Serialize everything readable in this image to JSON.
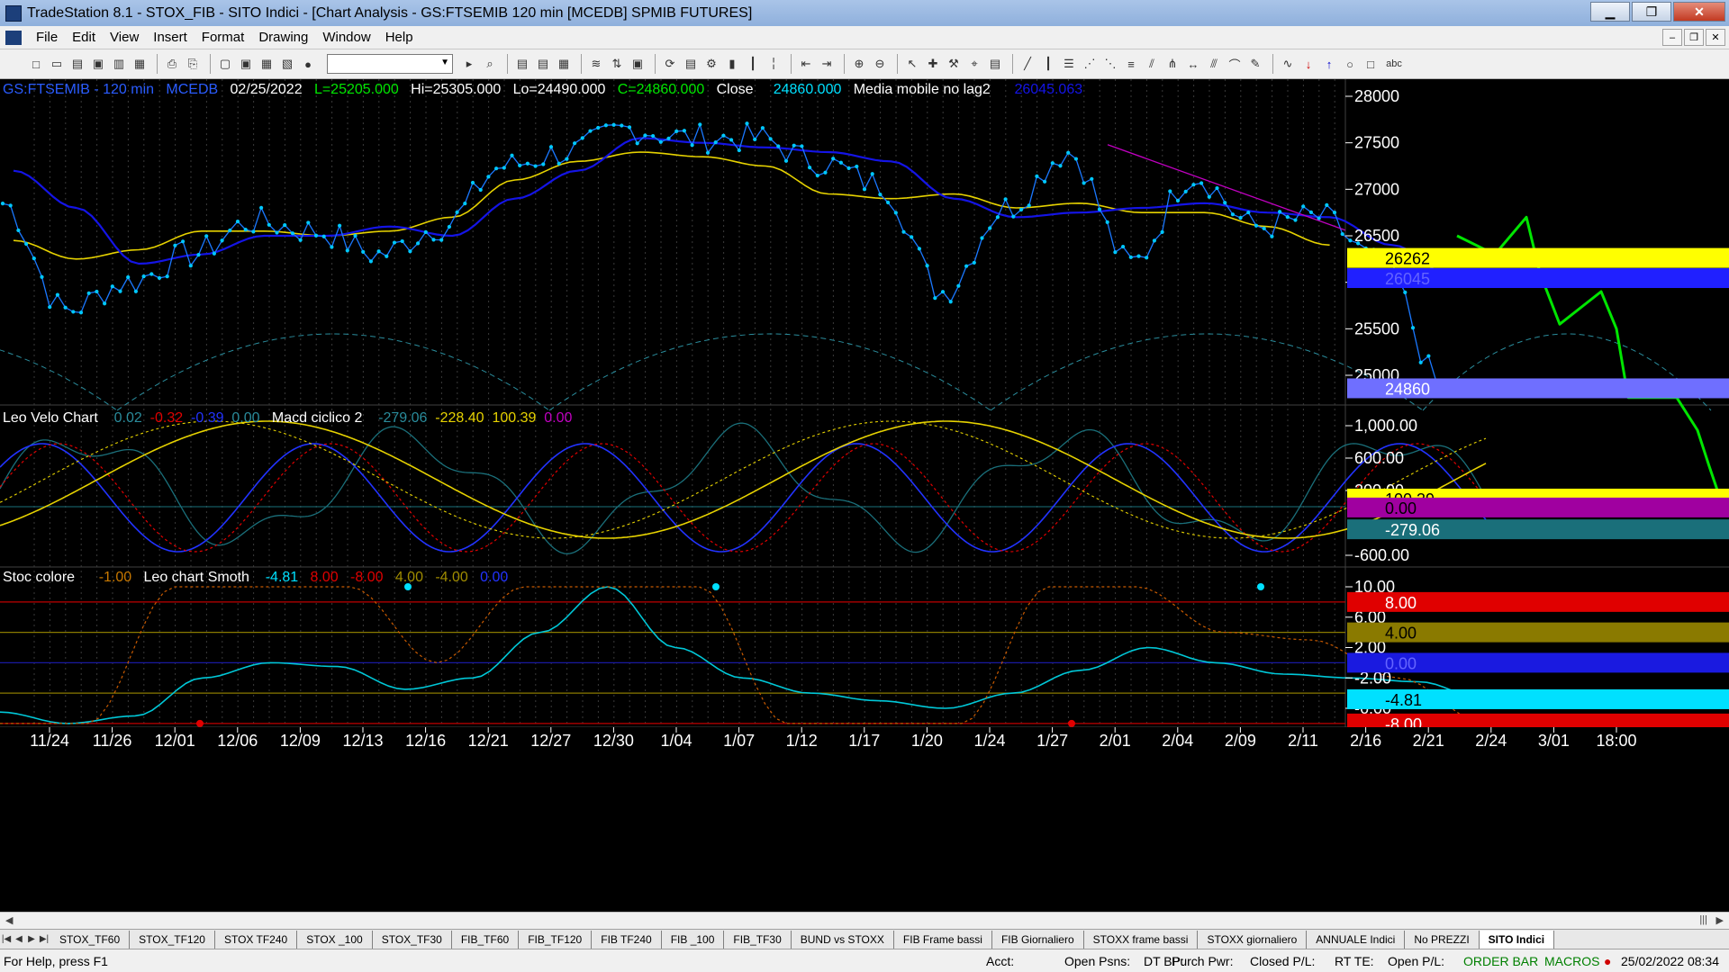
{
  "window": {
    "title": "TradeStation 8.1 - STOX_FIB - SITO Indici - [Chart Analysis - GS:FTSEMIB  120 min  [MCEDB] SPMIB FUTURES]"
  },
  "menu": [
    "File",
    "Edit",
    "View",
    "Insert",
    "Format",
    "Drawing",
    "Window",
    "Help"
  ],
  "price_header": {
    "symbol": "GS:FTSEMIB - 120 min",
    "data_source": "MCEDB",
    "date": "02/25/2022",
    "last": "L=25205.000",
    "high": "Hi=25305.000",
    "low": "Lo=24490.000",
    "close_value": "C=24860.000",
    "close_label": "Close",
    "close_num": "24860.000",
    "ma_label": "Media mobile no lag2",
    "ma_value": "26045.063"
  },
  "velo_header": {
    "name": "Leo Velo Chart",
    "v1": "0.02",
    "v2": "-0.32",
    "v3": "-0.39",
    "v4": "0.00",
    "macd_name": "Macd ciclico 2",
    "m1": "-279.06",
    "m2": "-228.40",
    "m3": "100.39",
    "m4": "0.00"
  },
  "stoc_header": {
    "name": "Stoc colore",
    "s1": "-1.00",
    "smooth_name": "Leo chart Smoth",
    "s2": "-4.81",
    "s3": "8.00",
    "s4": "-8.00",
    "s5": "4.00",
    "s6": "-4.00",
    "s7": "0.00"
  },
  "colors": {
    "price": "#00c8ff",
    "blue_ma": "#1414e6",
    "yellow_ma": "#e6d200",
    "trendline": "#c000c0",
    "projection": "#00e600",
    "cycle": "#2a8c9c",
    "red": "#e00000",
    "background": "#000000"
  },
  "chart_data": [
    {
      "type": "line",
      "title": "GS:FTSEMIB - 120 min",
      "x": [
        "11/24",
        "11/26",
        "12/01",
        "12/06",
        "12/09",
        "12/13",
        "12/16",
        "12/21",
        "12/27",
        "12/30",
        "1/04",
        "1/07",
        "1/12",
        "1/17",
        "1/20",
        "1/24",
        "1/27",
        "2/01",
        "2/04",
        "2/09",
        "2/11",
        "2/16",
        "2/21",
        "2/24"
      ],
      "x_axis_labels": [
        "11/24",
        "11/26",
        "12/01",
        "12/06",
        "12/09",
        "12/13",
        "12/16",
        "12/21",
        "12/27",
        "12/30",
        "1/04",
        "1/07",
        "1/12",
        "1/17",
        "1/20",
        "1/24",
        "1/27",
        "2/01",
        "2/04",
        "2/09",
        "2/11",
        "2/16",
        "2/21",
        "2/24",
        "3/01",
        "18:00"
      ],
      "y_ticks": [
        "28000",
        "27500",
        "27000",
        "26500",
        "26000",
        "25500",
        "25000"
      ],
      "ylim": [
        24400,
        28100
      ],
      "series": [
        {
          "name": "Close",
          "values": [
            26850,
            25700,
            26000,
            26300,
            26650,
            26550,
            26300,
            26600,
            27250,
            27400,
            27650,
            27550,
            27550,
            27300,
            27050,
            25900,
            26800,
            27400,
            26200,
            27150,
            26600,
            26700,
            26200,
            24860
          ]
        },
        {
          "name": "Media mobile no lag2",
          "values": [
            27200,
            26800,
            26200,
            26300,
            26500,
            26500,
            26600,
            26500,
            26900,
            27200,
            27550,
            27500,
            27450,
            27400,
            27300,
            26900,
            26700,
            26750,
            26800,
            26850,
            26750,
            26700,
            26400,
            26045
          ]
        },
        {
          "name": "",
          "values": [
            26450,
            26250,
            26350,
            26550,
            26550,
            26500,
            26550,
            26700,
            27100,
            27300,
            27400,
            27350,
            27250,
            26950,
            26900,
            26950,
            26800,
            26850,
            26750,
            26750,
            26600,
            26400
          ]
        }
      ],
      "price_labels": [
        "26262",
        "26045",
        "24860"
      ],
      "forecast_series": {
        "x": [
          "2/24",
          "3/01",
          "18:00"
        ],
        "values": [
          26500,
          25500,
          24760
        ]
      }
    },
    {
      "type": "line",
      "title": "Leo Velo Chart",
      "y_ticks": [
        "1,000.00",
        "600.00",
        "200.00",
        "-600.00"
      ],
      "ylim": [
        -800,
        1100
      ],
      "price_labels": [
        "100.39",
        "0.00",
        "-279.06"
      ],
      "series": [
        {
          "name": "Macd ciclico 2",
          "values": [
            -279.06
          ]
        },
        {
          "name": "",
          "values": [
            -228.4
          ]
        },
        {
          "name": "",
          "values": [
            100.39
          ]
        }
      ]
    },
    {
      "type": "line",
      "title": "Stoc colore",
      "y_ticks": [
        "10.00",
        "6.00",
        "2.00",
        "-2.00",
        "-6.00"
      ],
      "ylim": [
        -8.5,
        10.5
      ],
      "price_labels": [
        "8.00",
        "4.00",
        "0.00",
        "-4.81",
        "-4.00",
        "-8.00"
      ],
      "series": [
        {
          "name": "Leo chart Smoth",
          "values": [
            -6.5,
            -8,
            -7,
            -2,
            0,
            -0.5,
            -3.5,
            -2,
            4,
            10,
            2,
            -2,
            -4,
            -5,
            -6,
            -4,
            -1,
            2,
            0,
            -1.5,
            -2,
            -2.5,
            -4.81
          ]
        },
        {
          "name": "",
          "values": [
            -8,
            -8,
            10,
            10,
            10,
            0,
            10,
            10,
            10,
            -8,
            -8,
            -8,
            10,
            10,
            4,
            3,
            -2,
            -8
          ]
        }
      ]
    }
  ],
  "tabs": [
    "STOX_TF60",
    "STOX_TF120",
    "STOX TF240",
    "STOX _100",
    "STOX_TF30",
    "FIB_TF60",
    "FIB_TF120",
    "FIB TF240",
    "FIB _100",
    "FIB_TF30",
    "BUND vs STOXX",
    "FIB Frame bassi",
    "FIB Giornaliero",
    "STOXX frame bassi",
    "STOXX giornaliero",
    "ANNUALE Indici",
    "No PREZZI",
    "SITO Indici"
  ],
  "status": {
    "help": "For Help, press F1",
    "acct": "Acct:",
    "open_psns": "Open Psns:",
    "dt_bp": "DT BP:",
    "purch_pwr": "Purch Pwr:",
    "closed_pl": "Closed P/L:",
    "rt_te": "RT TE:",
    "open_pl": "Open P/L:",
    "order_bar": "ORDER BAR",
    "macros": "MACROS",
    "datetime": "25/02/2022 08:34"
  }
}
